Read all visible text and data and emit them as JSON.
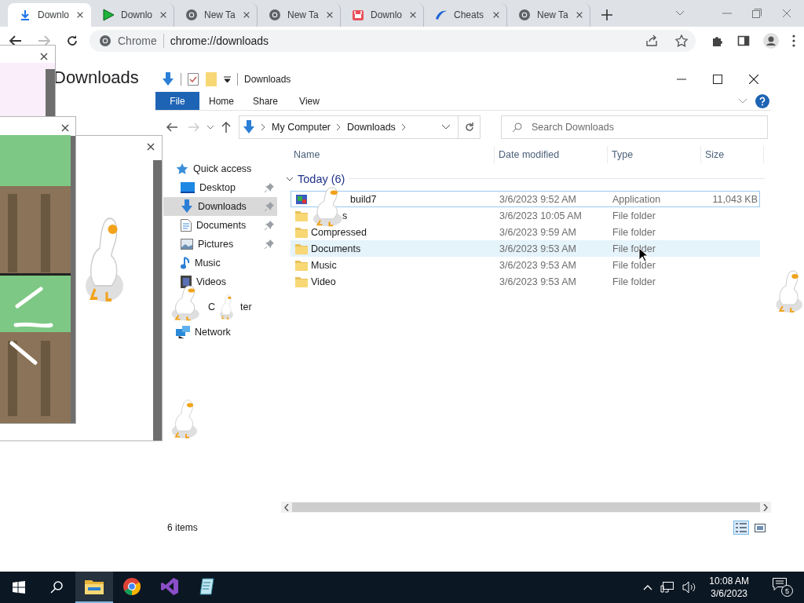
{
  "browser": {
    "tabs": [
      {
        "title": "Downlo",
        "kind": "download",
        "selected": true
      },
      {
        "title": "Downlo",
        "kind": "play",
        "selected": false
      },
      {
        "title": "New Ta",
        "kind": "chrome",
        "selected": false
      },
      {
        "title": "New Ta",
        "kind": "chrome",
        "selected": false
      },
      {
        "title": "Downlo",
        "kind": "store",
        "selected": false
      },
      {
        "title": "Cheats",
        "kind": "swoosh",
        "selected": false
      },
      {
        "title": "New Ta",
        "kind": "chrome",
        "selected": false
      }
    ],
    "omnibox": {
      "chip": "Chrome",
      "url": "chrome://downloads"
    },
    "page_title": "Downloads"
  },
  "note_windows": [
    {
      "kind": "tinted"
    },
    {
      "kind": "plain"
    },
    {
      "kind": "picture"
    }
  ],
  "explorer": {
    "title": "Downloads",
    "ribbon_tabs": [
      {
        "label": "File",
        "selected": true
      },
      {
        "label": "Home",
        "selected": false
      },
      {
        "label": "Share",
        "selected": false
      },
      {
        "label": "View",
        "selected": false
      }
    ],
    "breadcrumb": [
      "My Computer",
      "Downloads"
    ],
    "search": {
      "placeholder": "Search Downloads"
    },
    "nav": [
      {
        "label": "Quick access",
        "kind": "star",
        "selected": false,
        "children": [
          {
            "label": "Desktop",
            "kind": "desktop",
            "pinned": true,
            "selected": false
          },
          {
            "label": "Downloads",
            "kind": "download",
            "pinned": true,
            "selected": true
          },
          {
            "label": "Documents",
            "kind": "document",
            "pinned": true,
            "selected": false
          },
          {
            "label": "Pictures",
            "kind": "picture",
            "pinned": true,
            "selected": false
          },
          {
            "label": "Music",
            "kind": "music",
            "pinned": false,
            "selected": false
          },
          {
            "label": "Videos",
            "kind": "video",
            "pinned": false,
            "selected": false
          }
        ]
      },
      {
        "label": "C",
        "label_tail": "ter",
        "kind": "computer",
        "selected": false
      },
      {
        "label": "Network",
        "kind": "network",
        "selected": false
      }
    ],
    "columns": [
      "Name",
      "Date modified",
      "Type",
      "Size"
    ],
    "group": {
      "label": "Today (6)",
      "expanded": true
    },
    "rows": [
      {
        "name": "build7",
        "kind": "application",
        "date": "3/6/2023 9:52 AM",
        "type": "Application",
        "size": "11,043 KB",
        "selected": true,
        "hovered": false
      },
      {
        "name": "s",
        "kind": "folder",
        "date": "3/6/2023 10:05 AM",
        "type": "File folder",
        "selected": false,
        "hovered": false
      },
      {
        "name": "Compressed",
        "kind": "folder",
        "date": "3/6/2023 9:59 AM",
        "type": "File folder",
        "selected": false,
        "hovered": false
      },
      {
        "name": "Documents",
        "kind": "folder",
        "date": "3/6/2023 9:53 AM",
        "type": "File folder",
        "selected": false,
        "hovered": true
      },
      {
        "name": "Music",
        "kind": "folder",
        "date": "3/6/2023 9:53 AM",
        "type": "File folder",
        "selected": false,
        "hovered": false
      },
      {
        "name": "Video",
        "kind": "folder",
        "date": "3/6/2023 9:53 AM",
        "type": "File folder",
        "selected": false,
        "hovered": false
      }
    ],
    "status": "6 items",
    "views": [
      {
        "kind": "details",
        "selected": true
      },
      {
        "kind": "large_icons",
        "selected": false
      }
    ]
  },
  "taskbar": {
    "apps": [
      {
        "kind": "explorer",
        "active": true
      },
      {
        "kind": "chrome",
        "active": false
      },
      {
        "kind": "visual_studio",
        "active": false
      },
      {
        "kind": "notepad",
        "active": false
      }
    ],
    "time": "10:08 AM",
    "date": "3/6/2023",
    "notifications": "5"
  }
}
